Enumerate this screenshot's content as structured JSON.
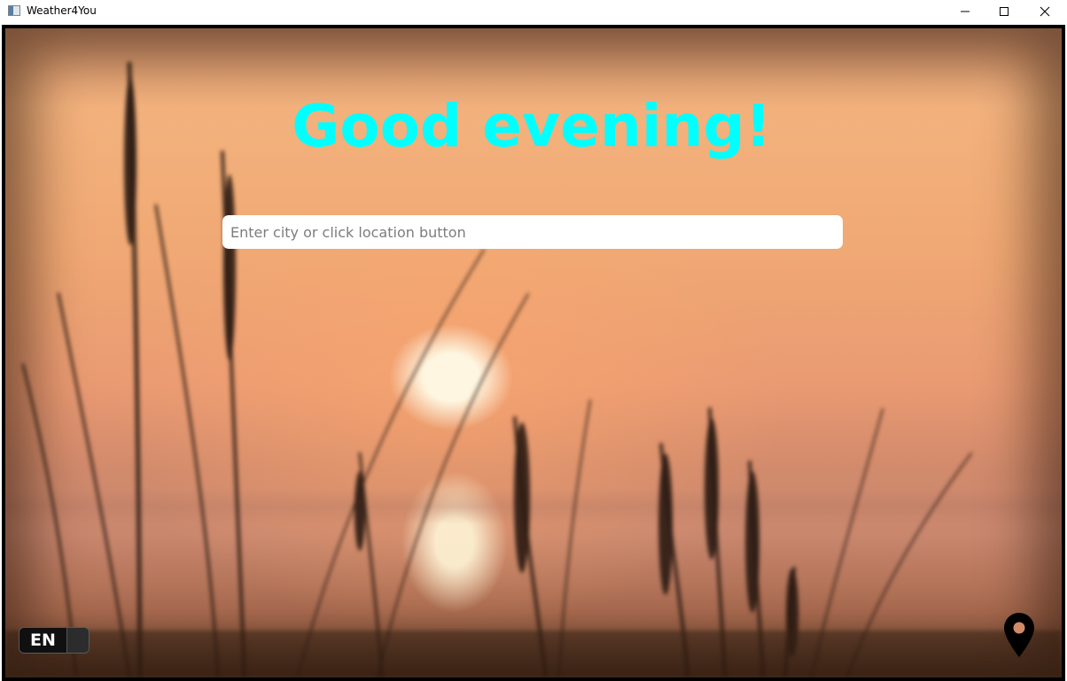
{
  "window": {
    "title": "Weather4You"
  },
  "main": {
    "greeting": "Good evening!",
    "search": {
      "placeholder": "Enter city or click location button",
      "value": ""
    },
    "language_toggle": {
      "label": "EN"
    }
  },
  "icons": {
    "app": "app-window-icon",
    "minimize": "minimize-icon",
    "maximize": "maximize-icon",
    "close": "close-icon",
    "location": "map-pin-icon"
  },
  "colors": {
    "greeting": "#00ffff",
    "search_bg": "#ffffff",
    "toggle_bg": "#101010"
  }
}
